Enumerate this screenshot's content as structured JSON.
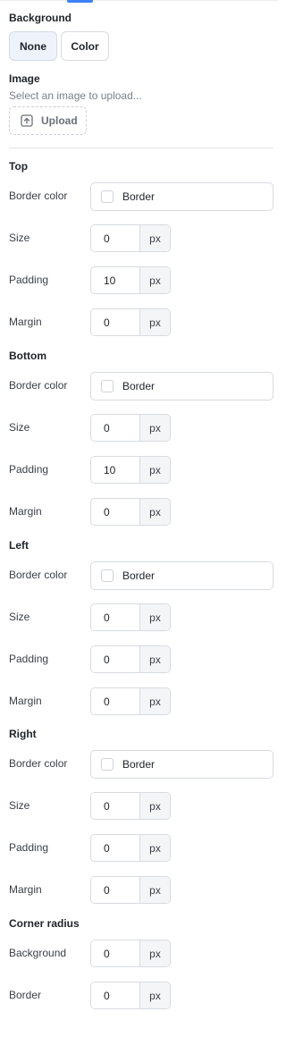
{
  "background": {
    "title": "Background",
    "options": [
      "None",
      "Color"
    ],
    "selected": "None"
  },
  "image": {
    "title": "Image",
    "hint": "Select an image to upload...",
    "upload_label": "Upload"
  },
  "labels": {
    "border_color": "Border color",
    "size": "Size",
    "padding": "Padding",
    "margin": "Margin",
    "unit": "px"
  },
  "sides": [
    {
      "title": "Top",
      "border_color": "Border",
      "size": "0",
      "padding": "10",
      "margin": "0"
    },
    {
      "title": "Bottom",
      "border_color": "Border",
      "size": "0",
      "padding": "10",
      "margin": "0"
    },
    {
      "title": "Left",
      "border_color": "Border",
      "size": "0",
      "padding": "0",
      "margin": "0"
    },
    {
      "title": "Right",
      "border_color": "Border",
      "size": "0",
      "padding": "0",
      "margin": "0"
    }
  ],
  "corner_radius": {
    "title": "Corner radius",
    "background_label": "Background",
    "background_value": "0",
    "border_label": "Border",
    "border_value": "0"
  },
  "colors": {
    "accent": "#3b82f6",
    "selected_bg": "#eef3fb",
    "border": "#d7dbe0"
  }
}
